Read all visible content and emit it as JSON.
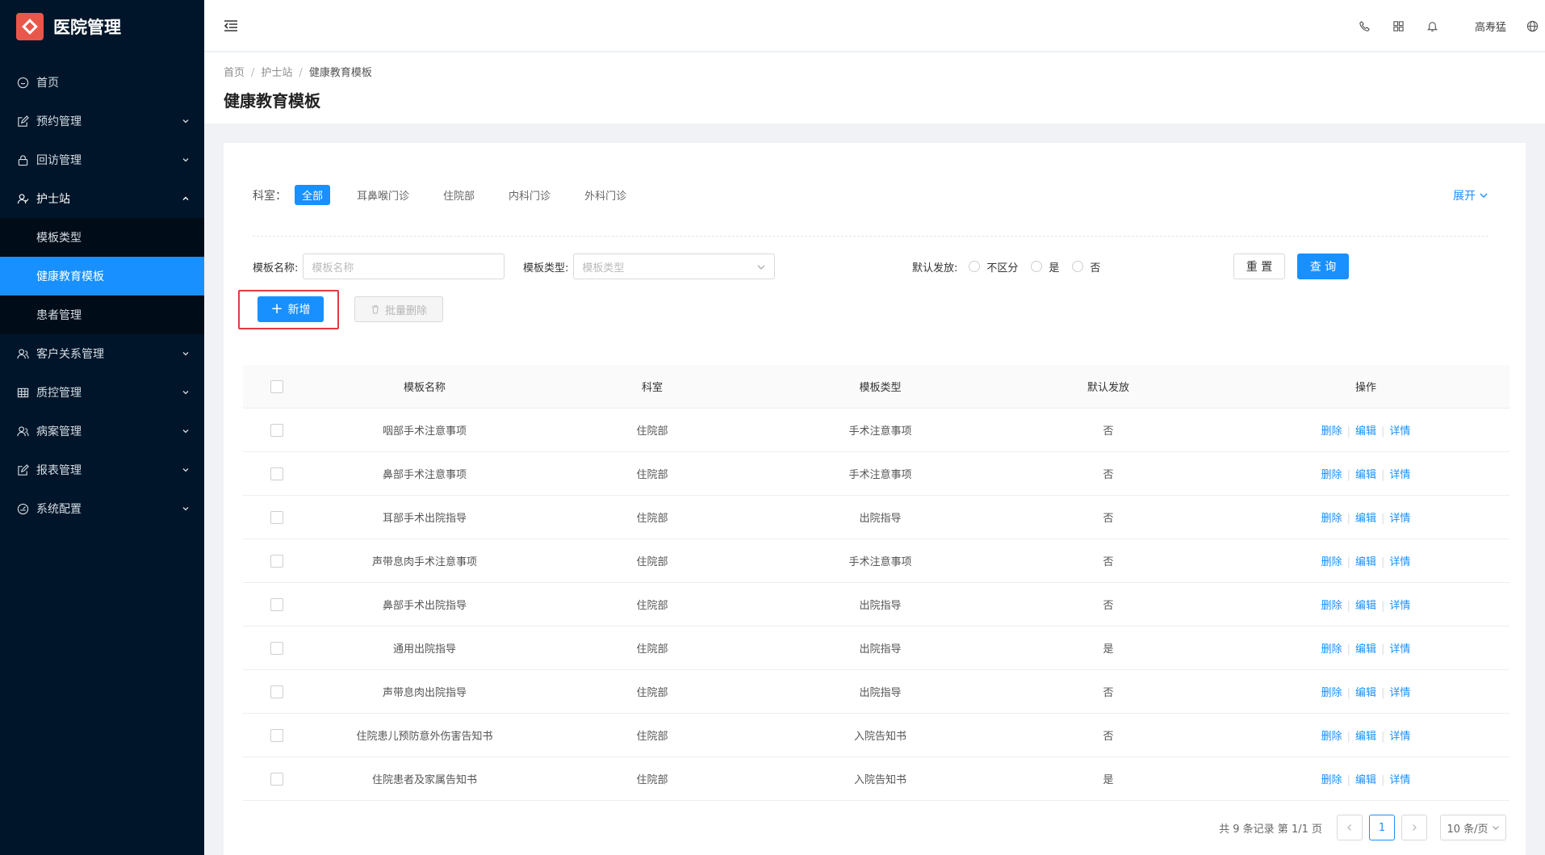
{
  "app": {
    "title": "医院管理",
    "accent": "#1890ff",
    "sidebar_bg": "#001529",
    "logo_color": "#e8574a"
  },
  "sidebar": {
    "items": [
      {
        "label": "首页",
        "icon": "home-icon"
      },
      {
        "label": "预约管理",
        "icon": "edit-icon"
      },
      {
        "label": "回访管理",
        "icon": "lock-icon"
      },
      {
        "label": "护士站",
        "icon": "user-icon",
        "open": true,
        "children": [
          {
            "label": "模板类型"
          },
          {
            "label": "健康教育模板",
            "active": true
          },
          {
            "label": "患者管理"
          }
        ]
      },
      {
        "label": "客户关系管理",
        "icon": "users-icon"
      },
      {
        "label": "质控管理",
        "icon": "table-icon"
      },
      {
        "label": "病案管理",
        "icon": "users-icon"
      },
      {
        "label": "报表管理",
        "icon": "edit-icon"
      },
      {
        "label": "系统配置",
        "icon": "dashboard-icon"
      }
    ]
  },
  "header": {
    "user_name": "高寿猛"
  },
  "breadcrumb": {
    "items": [
      "首页",
      "护士站",
      "健康教育模板"
    ]
  },
  "page": {
    "title": "健康教育模板"
  },
  "filters": {
    "dept_label": "科室：",
    "dept_tags": [
      "全部",
      "耳鼻喉门诊",
      "住院部",
      "内科门诊",
      "外科门诊"
    ],
    "expand_label": "展开"
  },
  "search": {
    "name_label": "模板名称:",
    "name_placeholder": "模板名称",
    "type_label": "模板类型:",
    "type_placeholder": "模板类型",
    "default_label": "默认发放:",
    "radio_options": [
      "不区分",
      "是",
      "否"
    ],
    "reset_label": "重 置",
    "query_label": "查 询"
  },
  "actions": {
    "add_label": "新增",
    "batch_delete_label": "批量删除"
  },
  "table": {
    "columns": [
      "模板名称",
      "科室",
      "模板类型",
      "默认发放",
      "操作"
    ],
    "op_labels": [
      "删除",
      "编辑",
      "详情"
    ],
    "rows": [
      {
        "name": "咽部手术注意事项",
        "dept": "住院部",
        "type": "手术注意事项",
        "default": "否"
      },
      {
        "name": "鼻部手术注意事项",
        "dept": "住院部",
        "type": "手术注意事项",
        "default": "否"
      },
      {
        "name": "耳部手术出院指导",
        "dept": "住院部",
        "type": "出院指导",
        "default": "否"
      },
      {
        "name": "声带息肉手术注意事项",
        "dept": "住院部",
        "type": "手术注意事项",
        "default": "否"
      },
      {
        "name": "鼻部手术出院指导",
        "dept": "住院部",
        "type": "出院指导",
        "default": "否"
      },
      {
        "name": "通用出院指导",
        "dept": "住院部",
        "type": "出院指导",
        "default": "是"
      },
      {
        "name": "声带息肉出院指导",
        "dept": "住院部",
        "type": "出院指导",
        "default": "否"
      },
      {
        "name": "住院患儿预防意外伤害告知书",
        "dept": "住院部",
        "type": "入院告知书",
        "default": "否"
      },
      {
        "name": "住院患者及家属告知书",
        "dept": "住院部",
        "type": "入院告知书",
        "default": "是"
      }
    ]
  },
  "pagination": {
    "summary": "共 9 条记录 第 1/1 页",
    "current_page": "1",
    "page_size": "10 条/页"
  }
}
